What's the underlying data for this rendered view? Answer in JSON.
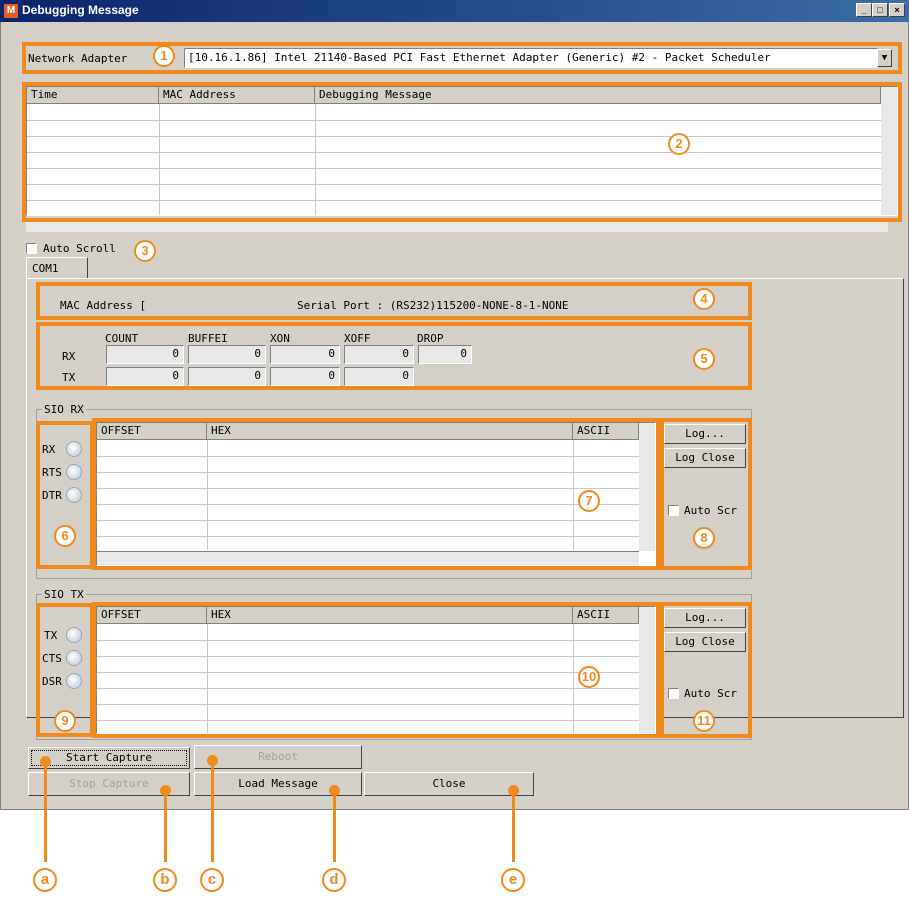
{
  "window": {
    "title": "Debugging Message",
    "app_icon": "M",
    "controls": [
      "_",
      "□",
      "×"
    ]
  },
  "adapter": {
    "label": "Network Adapter",
    "value": "[10.16.1.86] Intel 21140-Based PCI Fast Ethernet Adapter (Generic) #2 - Packet Scheduler"
  },
  "log_table": {
    "headers": [
      "Time",
      "MAC Address",
      "Debugging Message"
    ]
  },
  "auto_scroll": {
    "label": "Auto Scroll"
  },
  "tabs": [
    "COM1"
  ],
  "port_info": {
    "mac": "MAC Address [",
    "serial": "Serial Port : (RS232)115200-NONE-8-1-NONE"
  },
  "stats": {
    "columns": [
      "COUNT",
      "BUFFEI",
      "XON",
      "XOFF",
      "DROP"
    ],
    "rx_label": "RX",
    "tx_label": "TX",
    "rx": [
      "0",
      "0",
      "0",
      "0",
      "0"
    ],
    "tx": [
      "0",
      "0",
      "0",
      "0"
    ]
  },
  "sio_rx": {
    "title": "SIO RX",
    "leds": [
      "RX",
      "RTS",
      "DTR"
    ],
    "headers": [
      "OFFSET",
      "HEX",
      "ASCII"
    ],
    "log_button": "Log...",
    "log_close_button": "Log Close",
    "auto_scroll": "Auto Scr"
  },
  "sio_tx": {
    "title": "SIO TX",
    "leds": [
      "TX",
      "CTS",
      "DSR"
    ],
    "headers": [
      "OFFSET",
      "HEX",
      "ASCII"
    ],
    "log_button": "Log...",
    "log_close_button": "Log Close",
    "auto_scroll": "Auto Scr"
  },
  "buttons": {
    "start": "Start Capture",
    "reboot": "Reboot",
    "stop": "Stop Capture",
    "load": "Load Message",
    "close": "Close"
  },
  "badges": [
    "1",
    "2",
    "3",
    "4",
    "5",
    "6",
    "7",
    "8",
    "9",
    "10",
    "11"
  ],
  "callouts": [
    "a",
    "b",
    "c",
    "d",
    "e"
  ],
  "accent_color": "#f08a1c"
}
